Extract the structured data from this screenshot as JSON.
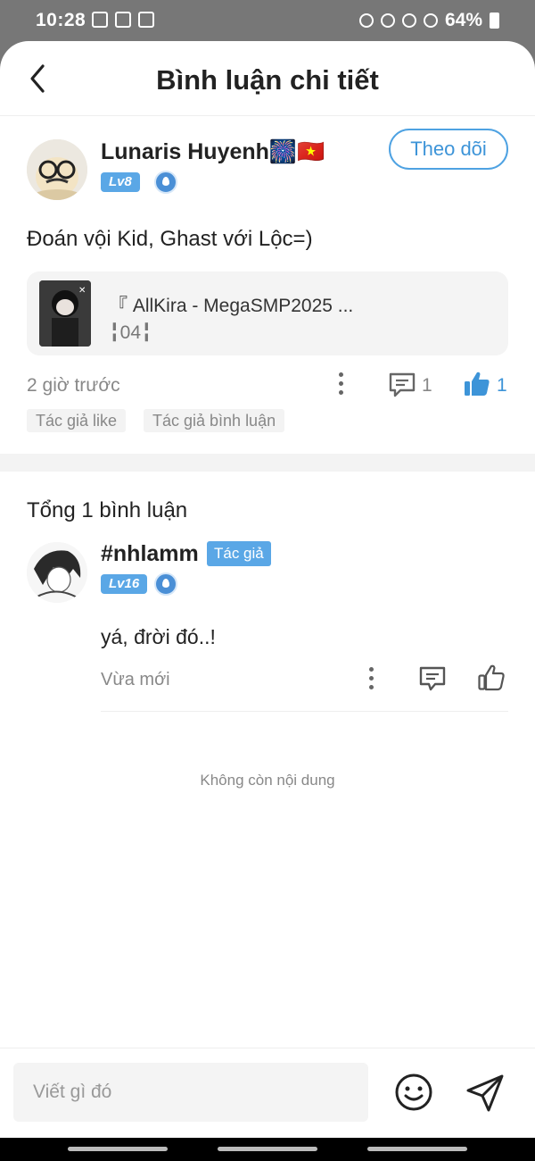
{
  "status_bar": {
    "time": "10:28",
    "battery": "64%"
  },
  "header": {
    "title": "Bình luận chi tiết"
  },
  "post": {
    "username": "Lunaris Huyenh🎆🇻🇳",
    "level": "Lv8",
    "follow_label": "Theo dõi",
    "text": "Đoán vội Kid, Ghast với Lộc=)",
    "attachment": {
      "title": "『 AllKira - MegaSMP2025 ...",
      "subtitle": "╏04╏"
    },
    "time": "2 giờ trước",
    "comment_count": "1",
    "like_count": "1",
    "tags": [
      "Tác giả like",
      "Tác giả bình luận"
    ]
  },
  "comments": {
    "total_label": "Tổng 1 bình luận",
    "items": [
      {
        "username": "#nhlamm",
        "author_tag": "Tác giả",
        "level": "Lv16",
        "text": "yá, đrời đó..!",
        "time": "Vừa mới"
      }
    ]
  },
  "end_label": "Không còn nội dung",
  "composer": {
    "placeholder": "Viết gì đó"
  },
  "colors": {
    "accent": "#4ea2e2",
    "badge": "#5aa7e6",
    "text": "#222222",
    "muted": "#888888"
  },
  "icons": [
    "back-arrow-icon",
    "more-vertical-icon",
    "comment-icon",
    "thumbs-up-icon",
    "emoji-icon",
    "send-icon",
    "verified-icon"
  ]
}
